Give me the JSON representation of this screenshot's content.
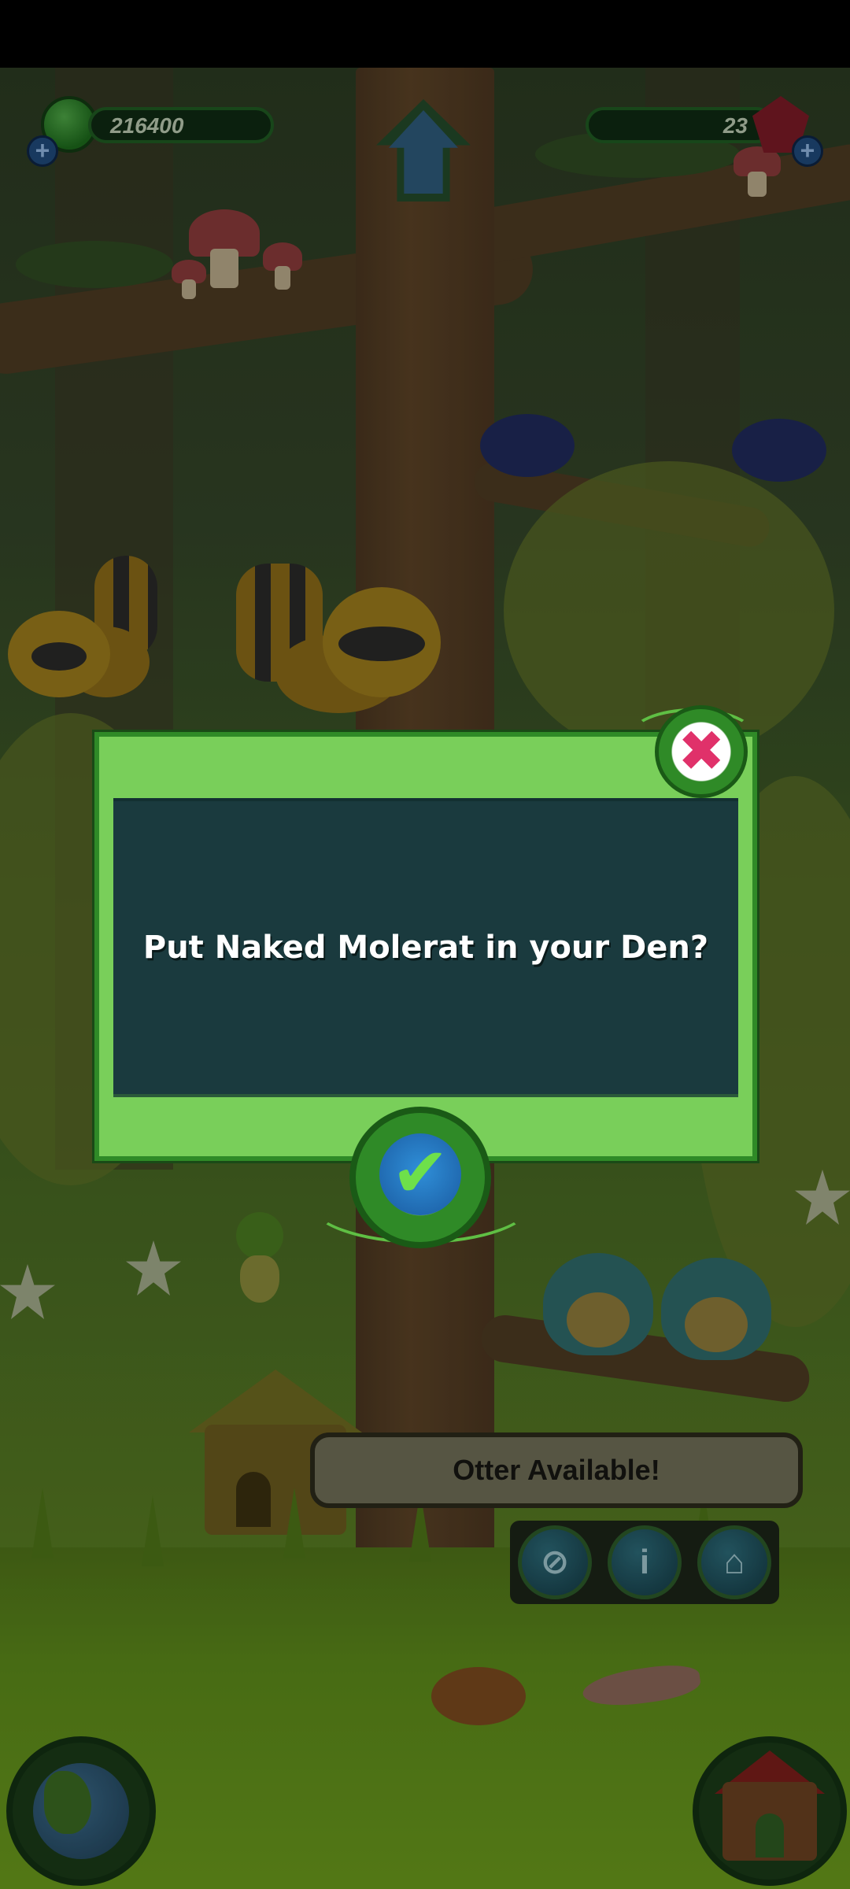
{
  "hud": {
    "coins": "216400",
    "gems": "23",
    "coin_icon": "green-gem-icon",
    "gem_icon": "red-crystal-icon",
    "add_icon": "plus-icon",
    "add_symbol": "+"
  },
  "dialog": {
    "message": "Put Naked Molerat in your Den?",
    "close_symbol": "✖",
    "confirm_symbol": "✔"
  },
  "banner": {
    "label": "Otter Available!"
  },
  "actions": [
    {
      "icon": "net-icon",
      "symbol": "⊘"
    },
    {
      "icon": "info-icon",
      "symbol": "i"
    },
    {
      "icon": "den-house-icon",
      "symbol": "⌂"
    }
  ],
  "colors": {
    "dialog_green": "#79cf5a",
    "panel_dark": "#1a3a3e",
    "close_pink": "#e0316a",
    "confirm_blue": "#2f8fd8"
  }
}
